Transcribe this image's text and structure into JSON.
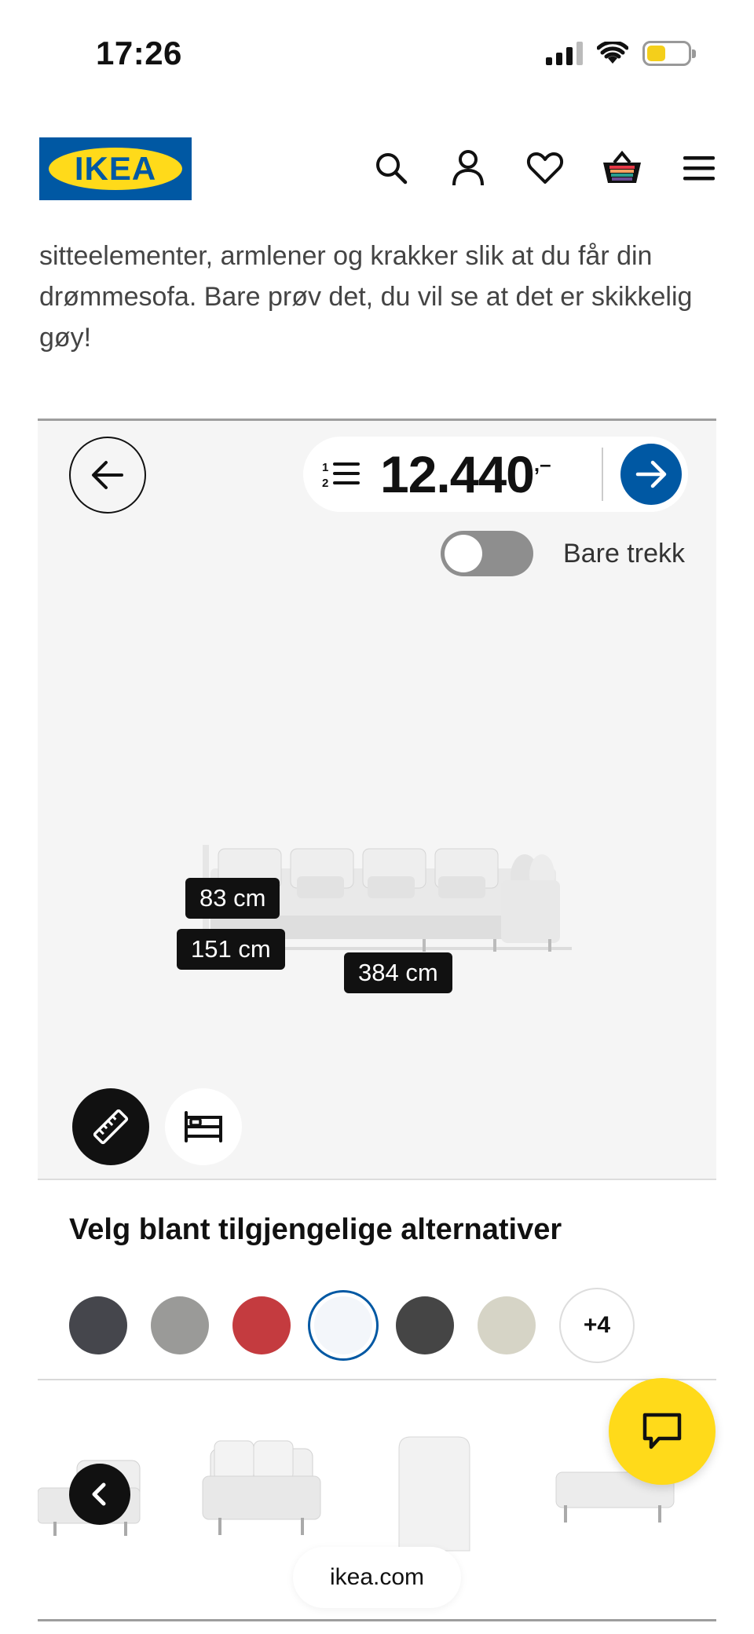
{
  "status_bar": {
    "time": "17:26"
  },
  "header": {
    "logo_text": "IKEA",
    "icons": [
      "search-icon",
      "account-icon",
      "heart-icon",
      "cart-icon",
      "menu-icon"
    ]
  },
  "intro_text": "sitteelementer, armlener og krakker slik at du får din drømmesofa. Bare prøv det, du vil se at det er skikkelig gøy!",
  "configurator": {
    "price": "12.440",
    "price_suffix": ",–",
    "toggle_label": "Bare trekk",
    "toggle_on": false,
    "dimensions": {
      "height": "83 cm",
      "depth": "151 cm",
      "width": "384 cm"
    }
  },
  "options": {
    "title": "Velg blant tilgjengelige alternativer",
    "swatches": [
      "#45464c",
      "#9a9a98",
      "#c43b3f",
      "#f3f6fa",
      "#454545",
      "#d6d4c6"
    ],
    "selected_index": 3,
    "more_label": "+4"
  },
  "browser": {
    "url": "ikea.com"
  },
  "colors": {
    "brand_blue": "#0058a3",
    "brand_yellow": "#ffda1a"
  }
}
